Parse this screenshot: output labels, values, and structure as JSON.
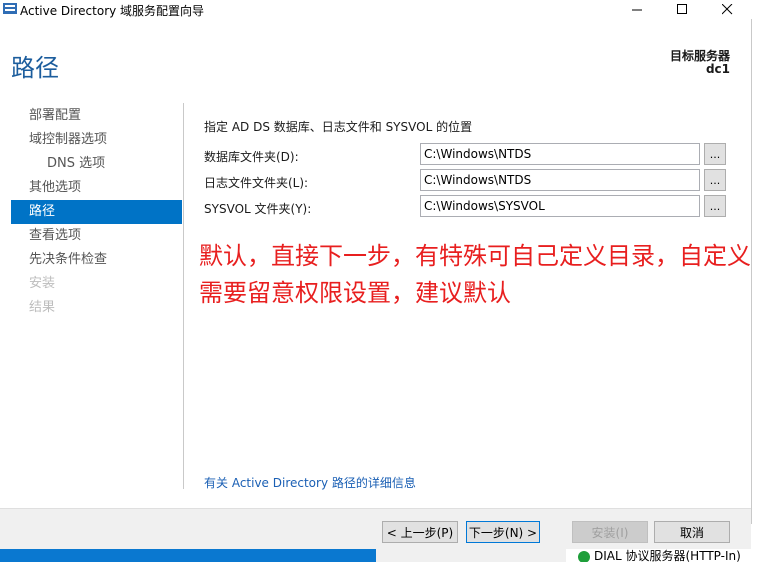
{
  "window": {
    "title": "Active Directory 域服务配置向导"
  },
  "header": {
    "page_title": "路径",
    "target_label": "目标服务器",
    "target_name": "dc1"
  },
  "sidebar": {
    "items": [
      {
        "label": "部署配置",
        "state": "normal"
      },
      {
        "label": "域控制器选项",
        "state": "normal"
      },
      {
        "label": "DNS 选项",
        "state": "sub"
      },
      {
        "label": "其他选项",
        "state": "normal"
      },
      {
        "label": "路径",
        "state": "active"
      },
      {
        "label": "查看选项",
        "state": "normal"
      },
      {
        "label": "先决条件检查",
        "state": "normal"
      },
      {
        "label": "安装",
        "state": "disabled"
      },
      {
        "label": "结果",
        "state": "disabled"
      }
    ]
  },
  "main": {
    "description": "指定 AD DS 数据库、日志文件和 SYSVOL 的位置",
    "fields": [
      {
        "label": "数据库文件夹(D):",
        "value": "C:\\Windows\\NTDS",
        "browse": "..."
      },
      {
        "label": "日志文件文件夹(L):",
        "value": "C:\\Windows\\NTDS",
        "browse": "..."
      },
      {
        "label": "SYSVOL 文件夹(Y):",
        "value": "C:\\Windows\\SYSVOL",
        "browse": "..."
      }
    ],
    "annotation": "默认，直接下一步，有特殊可自己定义目录，自定义需要留意权限设置，建议默认",
    "more_info_link": "有关 Active Directory 路径的详细信息"
  },
  "footer": {
    "prev_label": "< 上一步(P)",
    "next_label": "下一步(N) >",
    "install_label": "安装(I)",
    "cancel_label": "取消"
  },
  "background": {
    "item_text": "DIAL 协议服务器(HTTP-In)"
  },
  "colors": {
    "accent": "#0073c6",
    "title": "#1c5d9d",
    "annotation": "#e81f1f",
    "link": "#1a5fb4"
  }
}
